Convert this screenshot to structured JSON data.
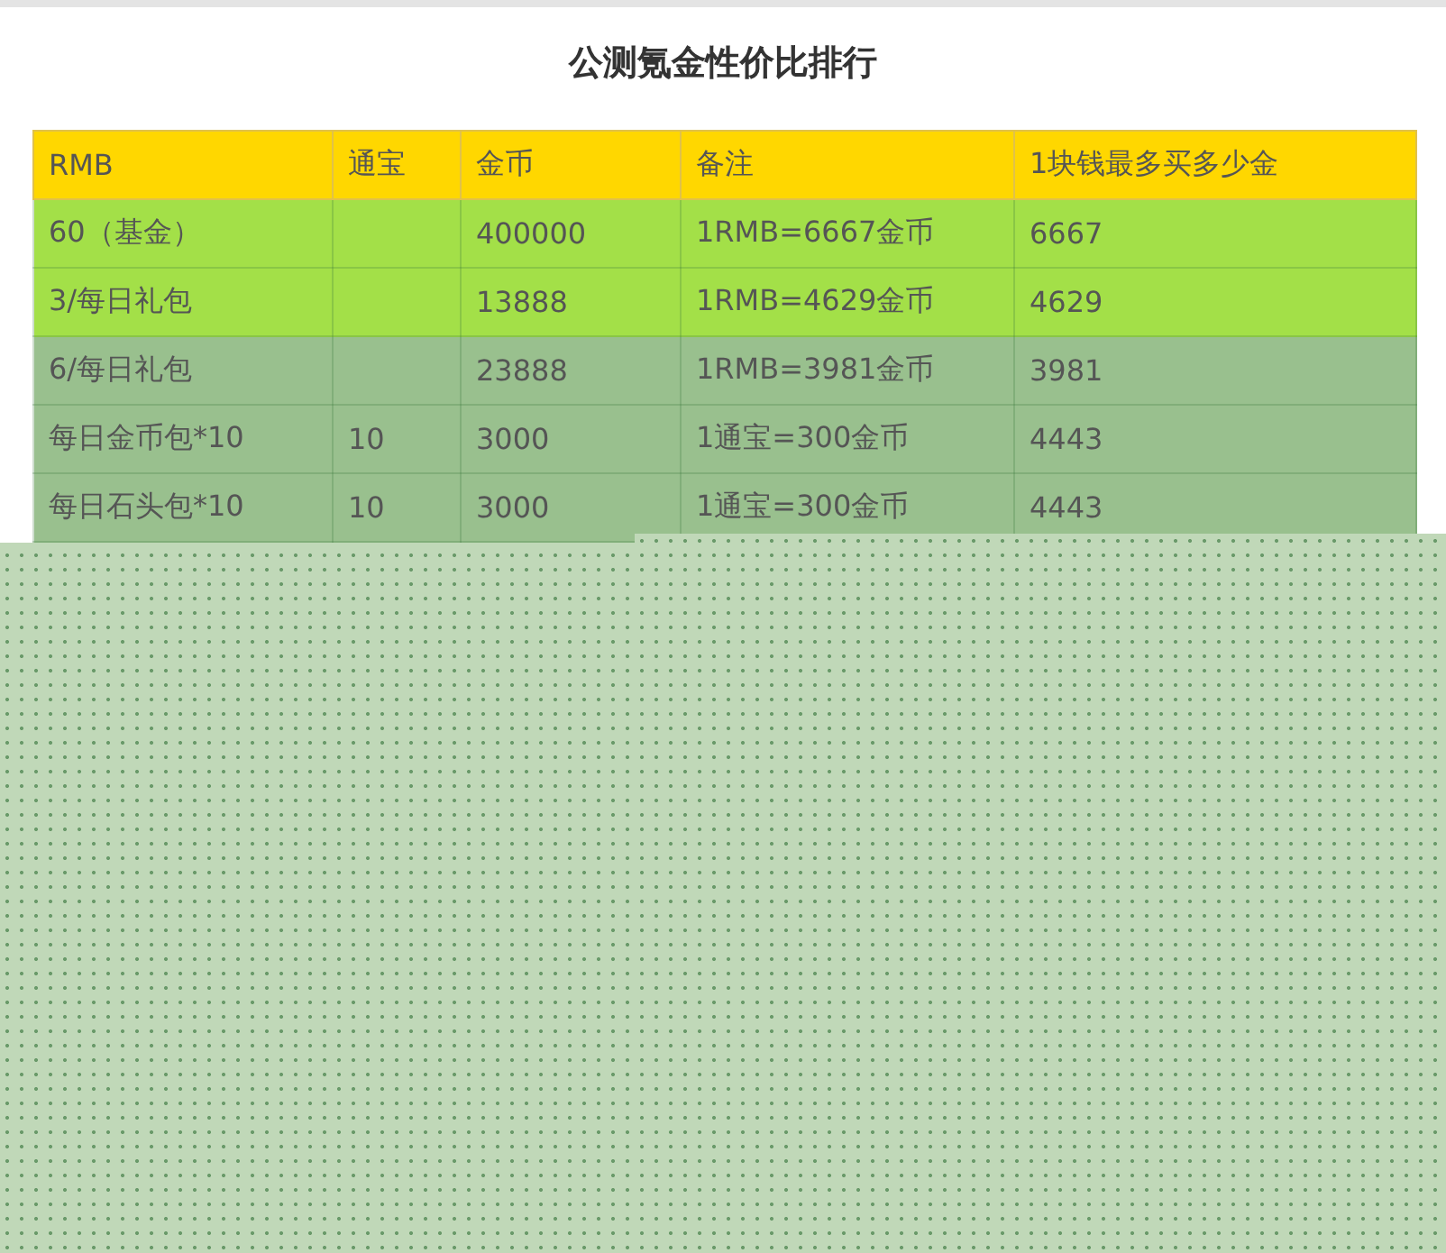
{
  "title": "公测氪金性价比排行",
  "table": {
    "columns": [
      "RMB",
      "通宝",
      "金币",
      "备注",
      "1块钱最多买多少金"
    ],
    "rows": [
      {
        "color": "#a3e048",
        "cells": [
          "60（基金）",
          "",
          "400000",
          "1RMB=6667金币",
          "6667"
        ]
      },
      {
        "color": "#a3e048",
        "cells": [
          "3/每日礼包",
          "",
          "13888",
          "1RMB=4629金币",
          "4629"
        ]
      },
      {
        "color": "#99c08e",
        "cells": [
          "6/每日礼包",
          "",
          "23888",
          "1RMB=3981金币",
          "3981"
        ]
      },
      {
        "color": "#99c08e",
        "cells": [
          "每日金币包*10",
          "10",
          "3000",
          "1通宝=300金币",
          "4443"
        ]
      },
      {
        "color": "#99c08e",
        "cells": [
          "每日石头包*10",
          "10",
          "3000",
          "1通宝=300金币",
          "4443"
        ]
      }
    ]
  }
}
